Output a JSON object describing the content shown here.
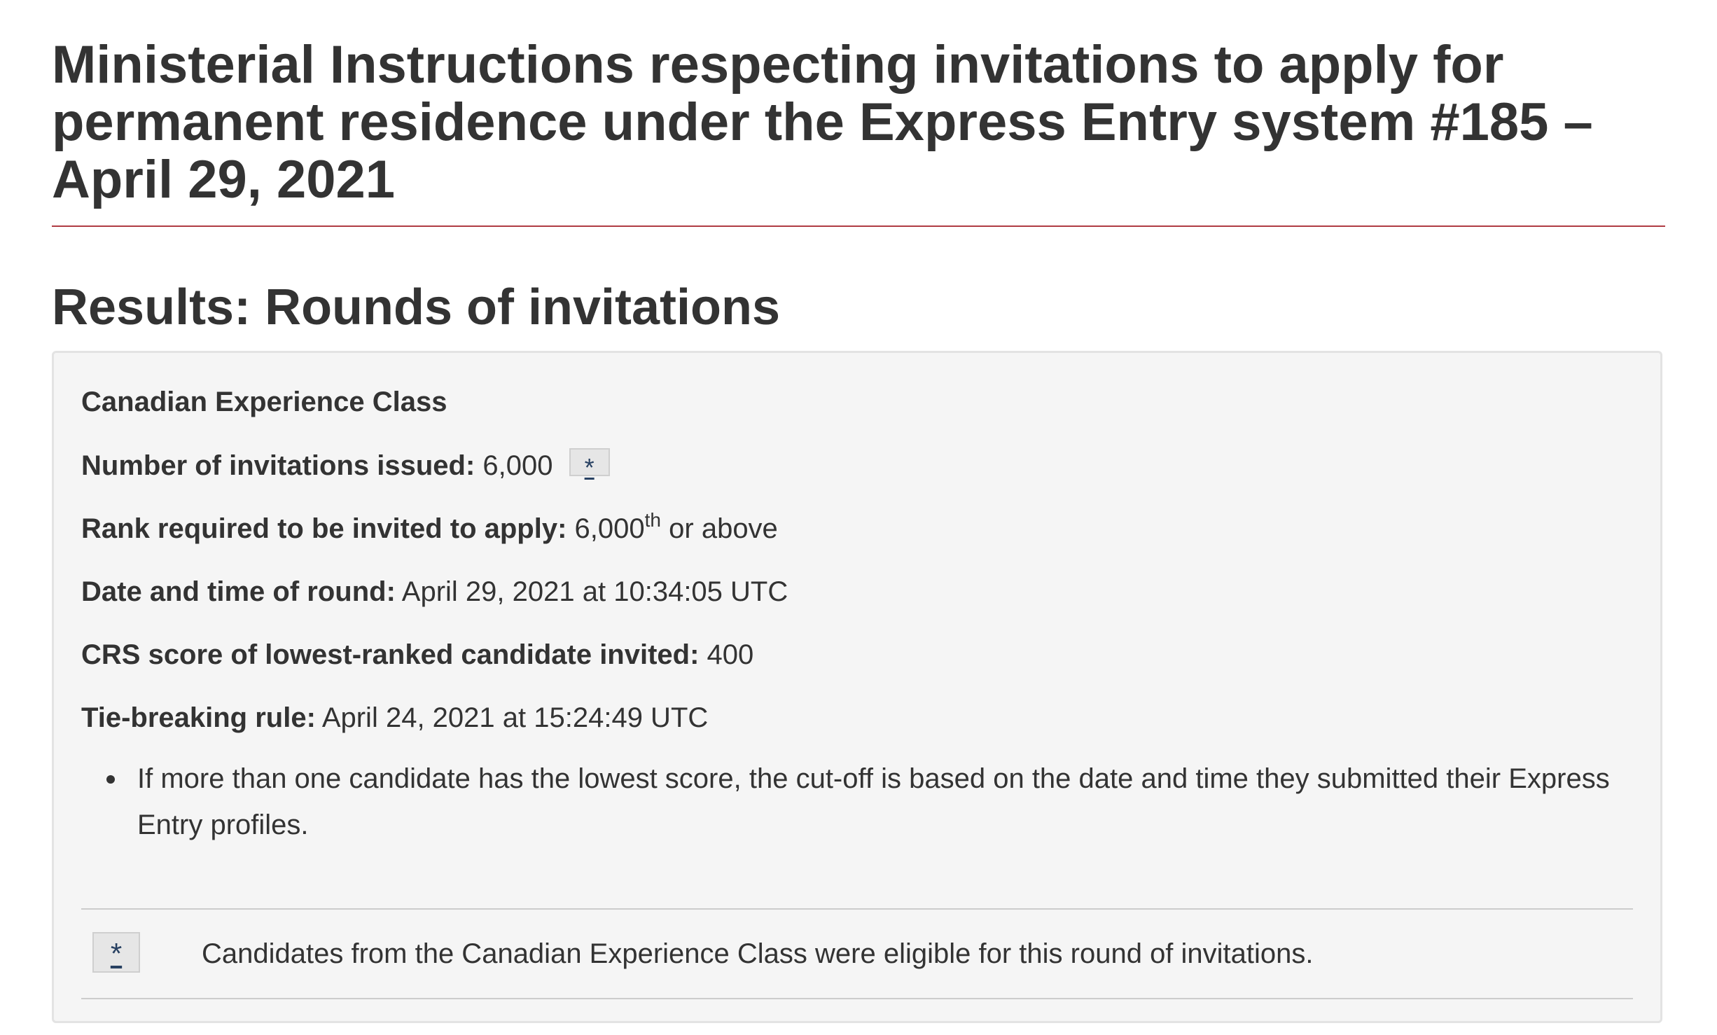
{
  "page": {
    "title": "Ministerial Instructions respecting invitations to apply for permanent residence under the Express Entry system #185 – April 29, 2021",
    "section_title": "Results: Rounds of invitations"
  },
  "results": {
    "class_name": "Canadian Experience Class",
    "invitations": {
      "label": "Number of invitations issued:",
      "value": "6,000",
      "footnote_ref": "*"
    },
    "rank": {
      "label": "Rank required to be invited to apply:",
      "value": "6,000",
      "ordinal_suffix": "th",
      "qualifier": "or above"
    },
    "round_datetime": {
      "label": "Date and time of round:",
      "value": "April 29, 2021 at 10:34:05 UTC"
    },
    "crs_score": {
      "label": "CRS score of lowest-ranked candidate invited:",
      "value": "400"
    },
    "tie_breaking": {
      "label": "Tie-breaking rule:",
      "value": "April 24, 2021 at 15:24:49 UTC"
    },
    "notes": [
      "If more than one candidate has the lowest score, the cut-off is based on the date and time they submitted their Express Entry profiles."
    ],
    "footnote": {
      "marker": "*",
      "text": "Candidates from the Canadian Experience Class were eligible for this round of invitations."
    }
  },
  "colors": {
    "title_rule": "#af3c43",
    "panel_background": "#f5f5f5",
    "link": "#284162",
    "text": "#333333"
  }
}
